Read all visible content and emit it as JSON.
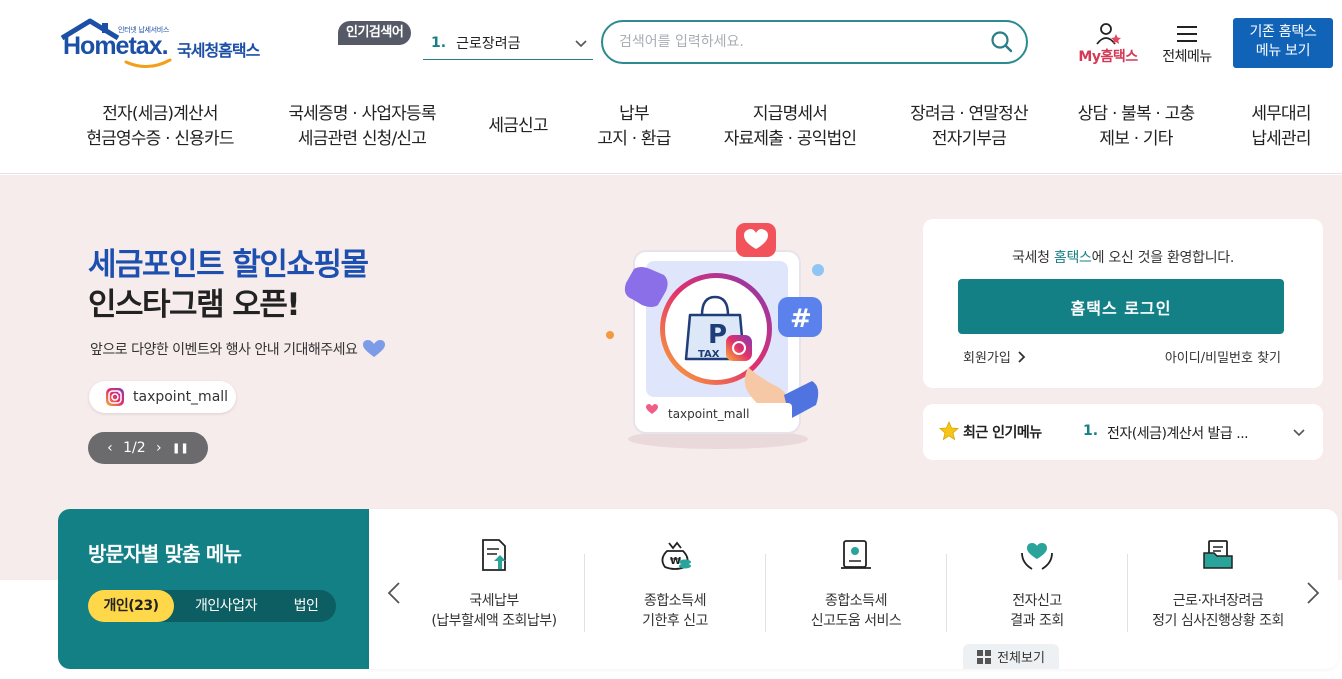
{
  "header": {
    "logo_tagline": "인터넷 납세서비스",
    "logo_main": "Hometax.",
    "logo_kr": "국세청홈택스",
    "popular_badge": "인기검색어",
    "popular_num": "1.",
    "popular_text": "근로장려금",
    "search_placeholder": "검색어를 입력하세요.",
    "my_hometax": "My홈택스",
    "all_menu": "전체메뉴",
    "old_hometax_line1": "기존 홈택스",
    "old_hometax_line2": "메뉴 보기"
  },
  "gnb": [
    {
      "line1": "전자(세금)계산서",
      "line2": "현금영수증 · 신용카드"
    },
    {
      "line1": "국세증명 · 사업자등록",
      "line2": "세금관련 신청/신고"
    },
    {
      "line1": "세금신고",
      "line2": ""
    },
    {
      "line1": "납부",
      "line2": "고지 · 환급"
    },
    {
      "line1": "지급명세서",
      "line2": "자료제출 · 공익법인"
    },
    {
      "line1": "장려금 · 연말정산",
      "line2": "전자기부금"
    },
    {
      "line1": "상담 · 불복 · 고충",
      "line2": "제보 · 기타"
    },
    {
      "line1": "세무대리",
      "line2": "납세관리"
    }
  ],
  "hero": {
    "title1": "세금포인트 할인쇼핑몰",
    "title2": "인스타그램 오픈!",
    "subtitle": "앞으로 다양한 이벤트와 행사 안내 기대해주세요",
    "insta_handle": "taxpoint_mall",
    "illust_label": "taxpoint_mall",
    "illust_bag_text": "P",
    "illust_bag_sub": "TAX",
    "pager_prev": "‹",
    "pager_text": "1/2",
    "pager_next": "›",
    "pager_pause": "❚❚"
  },
  "login": {
    "welcome_pre": "국세청 ",
    "welcome_hl": "홈택스",
    "welcome_post": "에 오신 것을 환영합니다.",
    "login_button": "홈택스 로그인",
    "signup": "회원가입",
    "find_id": "아이디/비밀번호 찾기"
  },
  "popular_menu": {
    "title": "최근 인기메뉴",
    "num": "1.",
    "text": "전자(세금)계산서 발급 ..."
  },
  "visitor": {
    "title": "방문자별 맞춤 메뉴",
    "tabs": [
      "개인(23)",
      "개인사업자",
      "법인"
    ],
    "services": [
      {
        "line1": "국세납부",
        "line2": "(납부할세액 조회납부)",
        "icon": "document-upload-icon"
      },
      {
        "line1": "종합소득세",
        "line2": "기한후 신고",
        "icon": "money-bag-icon"
      },
      {
        "line1": "종합소득세",
        "line2": "신고도움 서비스",
        "icon": "certificate-icon"
      },
      {
        "line1": "전자신고",
        "line2": "결과 조회",
        "icon": "heart-hands-icon"
      },
      {
        "line1": "근로·자녀장려금",
        "line2": "정기 심사진행상황 조회",
        "icon": "folder-document-icon"
      }
    ],
    "view_all": "전체보기"
  },
  "colors": {
    "brand_teal": "#138086",
    "brand_blue": "#1c4fa6",
    "hero_bg": "#f7ecec",
    "accent_yellow": "#ffd84a",
    "accent_pink": "#d43a56"
  }
}
